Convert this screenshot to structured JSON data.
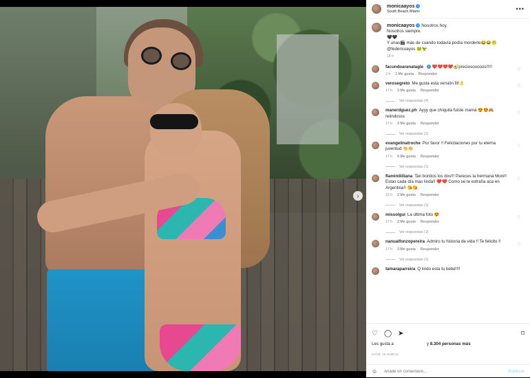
{
  "post": {
    "username": "monicaayos",
    "location": "South Beach Miami",
    "caption_lines": [
      "Nosotros hoy.",
      "Nosotros siempre.",
      "🖤🖤",
      "Y unas🎬 más de cuando todavía podía morderte😂😂🙃",
      "@federicoayos 🐸🦖"
    ],
    "caption_time": "18 h",
    "carousel_dots": 7,
    "active_dot": 0
  },
  "comments": [
    {
      "user": "facundoaranatagle",
      "verified": true,
      "text": "❤️❤️❤️❤️🥑preciosooooos!!!!!",
      "time": "2 h",
      "likes": "1 Me gusta",
      "reply": "Responder",
      "view_replies": ""
    },
    {
      "user": "verosegreto",
      "verified": false,
      "text": "Me gusta esta versión fit!👌",
      "time": "17 h",
      "likes": "3 Me gusta",
      "reply": "Responder",
      "view_replies": "Ver respuestas (4)"
    },
    {
      "user": "manerdguez.ph",
      "verified": false,
      "text": "Ayyy que chiquita fuiste mamá 😍😍🙈 reiindosss",
      "time": "17 h",
      "likes": "3 Me gusta",
      "reply": "Responder",
      "view_replies": "Ver respuestas (1)"
    },
    {
      "user": "evangelinatroche",
      "verified": false,
      "text": "Por favor !! Felicitaciones por tu eterna juventud 👏👏",
      "time": "17 h",
      "likes": "6 Me gusta",
      "reply": "Responder",
      "view_replies": "Ver respuestas (1)"
    },
    {
      "user": "flaminiliiliana",
      "verified": false,
      "text": "Tan bonitos los dos!!! Pareces la hermana Moni!! Estas cada día mas linda!! ❤️❤️ Como se te extraña aca en Argentina!! 😘😘",
      "time": "16 h",
      "likes": "2 Me gusta",
      "reply": "Responder",
      "view_replies": "Ver respuestas (1)"
    },
    {
      "user": "missolgui",
      "verified": false,
      "text": "La última foto 😍",
      "time": "17 h",
      "likes": "2 Me gusta",
      "reply": "Responder",
      "view_replies": "Ver respuestas (1)"
    },
    {
      "user": "nanualfonzopereira",
      "verified": false,
      "text": "Admiro tu historia de vida !! Te felicito !!",
      "time": "17 h",
      "likes": "3 Me gusta",
      "reply": "Responder",
      "view_replies": "Ver respuestas (1)"
    },
    {
      "user": "tamaraparreira",
      "verified": false,
      "text": "Q lindo esta tu bebé!!!!",
      "time": "",
      "likes": "",
      "reply": "",
      "view_replies": ""
    }
  ],
  "footer": {
    "likes_prefix": "Les gusta a",
    "likes_suffix": "y",
    "likes_count": "8.304 personas más",
    "timestamp": "HACE 18 HORAS",
    "comment_placeholder": "Añade un comentario...",
    "post_label": "Publicar"
  },
  "icons": {
    "more": "more-options-icon",
    "next": "chevron-right-icon",
    "like": "heart-icon",
    "comment": "comment-icon",
    "share": "share-icon",
    "save": "bookmark-icon",
    "emoji": "emoji-icon",
    "comment_like": "small-heart-icon"
  },
  "colors": {
    "verified": "#3897f0",
    "secondary_text": "#8e8e8e",
    "post_button_disabled": "#b2dffc"
  }
}
